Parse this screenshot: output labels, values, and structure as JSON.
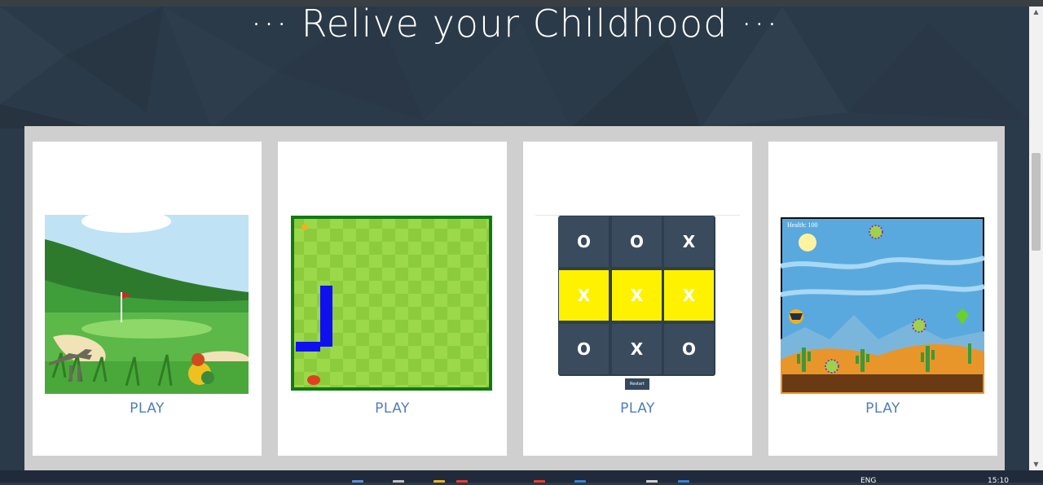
{
  "page": {
    "heading": "··· Relive your Childhood ···"
  },
  "games": [
    {
      "name": "golf",
      "play_label": "PLAY"
    },
    {
      "name": "snake",
      "play_label": "PLAY"
    },
    {
      "name": "tic-tac-toe",
      "play_label": "PLAY",
      "board": [
        "O",
        "O",
        "X",
        "X",
        "X",
        "X",
        "O",
        "X",
        "O"
      ],
      "restart_label": "Restart"
    },
    {
      "name": "dino-runner",
      "play_label": "PLAY",
      "health_text": "Health: 100"
    }
  ],
  "colors": {
    "background": "#2b3a48",
    "panel": "#cfcfcf",
    "card": "#ffffff",
    "play_link": "#4f7fb8",
    "ttt_win": "#fff200"
  },
  "taskbar": {
    "lang": "ENG",
    "time": "15:10"
  }
}
